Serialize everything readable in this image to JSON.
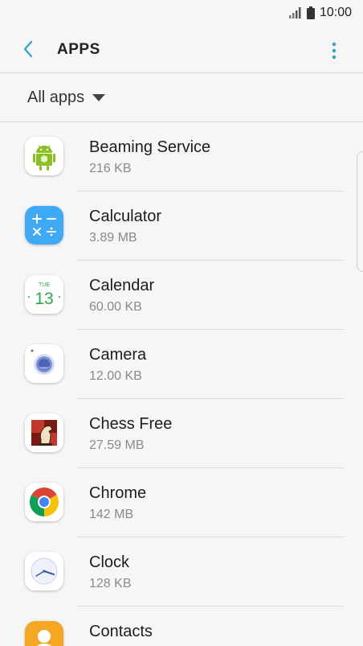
{
  "status": {
    "time": "10:00"
  },
  "header": {
    "title": "APPS"
  },
  "filter": {
    "label": "All apps"
  },
  "apps": [
    {
      "name": "Beaming Service",
      "size": "216 KB",
      "icon": "android-icon"
    },
    {
      "name": "Calculator",
      "size": "3.89 MB",
      "icon": "calculator-icon"
    },
    {
      "name": "Calendar",
      "size": "60.00 KB",
      "icon": "calendar-icon",
      "icon_day": "TUE",
      "icon_date": "13"
    },
    {
      "name": "Camera",
      "size": "12.00 KB",
      "icon": "camera-icon"
    },
    {
      "name": "Chess Free",
      "size": "27.59 MB",
      "icon": "chess-icon"
    },
    {
      "name": "Chrome",
      "size": "142 MB",
      "icon": "chrome-icon"
    },
    {
      "name": "Clock",
      "size": "128 KB",
      "icon": "clock-icon"
    },
    {
      "name": "Contacts",
      "size": "",
      "icon": "contacts-icon"
    }
  ],
  "colors": {
    "accent": "#3aa7c9",
    "calculator": "#3fa9f5",
    "contacts": "#f5a623"
  }
}
